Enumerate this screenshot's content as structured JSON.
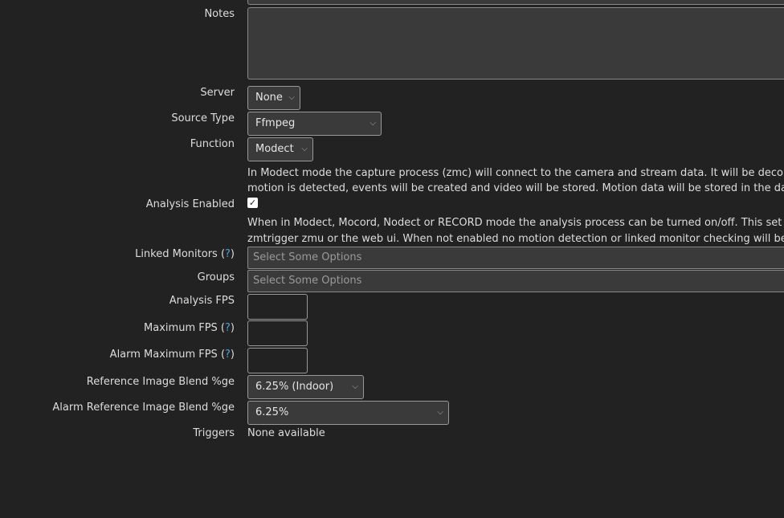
{
  "fields": {
    "notes": {
      "label": "Notes",
      "value": ""
    },
    "server": {
      "label": "Server",
      "value": "None"
    },
    "source_type": {
      "label": "Source Type",
      "value": "Ffmpeg"
    },
    "function": {
      "label": "Function",
      "value": "Modect",
      "help": [
        "In Modect mode the capture process (zmc) will connect to the camera and stream data. It will be deco",
        "motion is detected, events will be created and video will be stored. Motion data will be stored in the da"
      ]
    },
    "analysis_enabled": {
      "label": "Analysis Enabled",
      "checked": true,
      "help": [
        "When in Modect, Mocord, Nodect or RECORD mode the analysis process can be turned on/off. This set",
        "zmtrigger zmu or the web ui. When not enabled no motion detection or linked monitor checking will be"
      ]
    },
    "linked_monitors": {
      "label": "Linked Monitors (",
      "help_link": "?",
      "label_end": ")",
      "placeholder": "Select Some Options"
    },
    "groups": {
      "label": "Groups",
      "placeholder": "Select Some Options"
    },
    "analysis_fps": {
      "label": "Analysis FPS",
      "value": ""
    },
    "maximum_fps": {
      "label": "Maximum FPS (",
      "help_link": "?",
      "label_end": ")",
      "value": ""
    },
    "alarm_maximum_fps": {
      "label": "Alarm Maximum FPS (",
      "help_link": "?",
      "label_end": ")",
      "value": ""
    },
    "reference_blend": {
      "label": "Reference Image Blend %ge",
      "value": "6.25% (Indoor)"
    },
    "alarm_reference_blend": {
      "label": "Alarm Reference Image Blend %ge",
      "value": "6.25%"
    },
    "triggers": {
      "label": "Triggers",
      "value": "None available"
    }
  },
  "colors": {
    "background": "#222222",
    "help_link": "#4aa3df",
    "input_bg": "#3a3a3a"
  },
  "icons": {
    "select_chevron": "chevron-down-icon",
    "checkbox_check": "check-icon"
  }
}
